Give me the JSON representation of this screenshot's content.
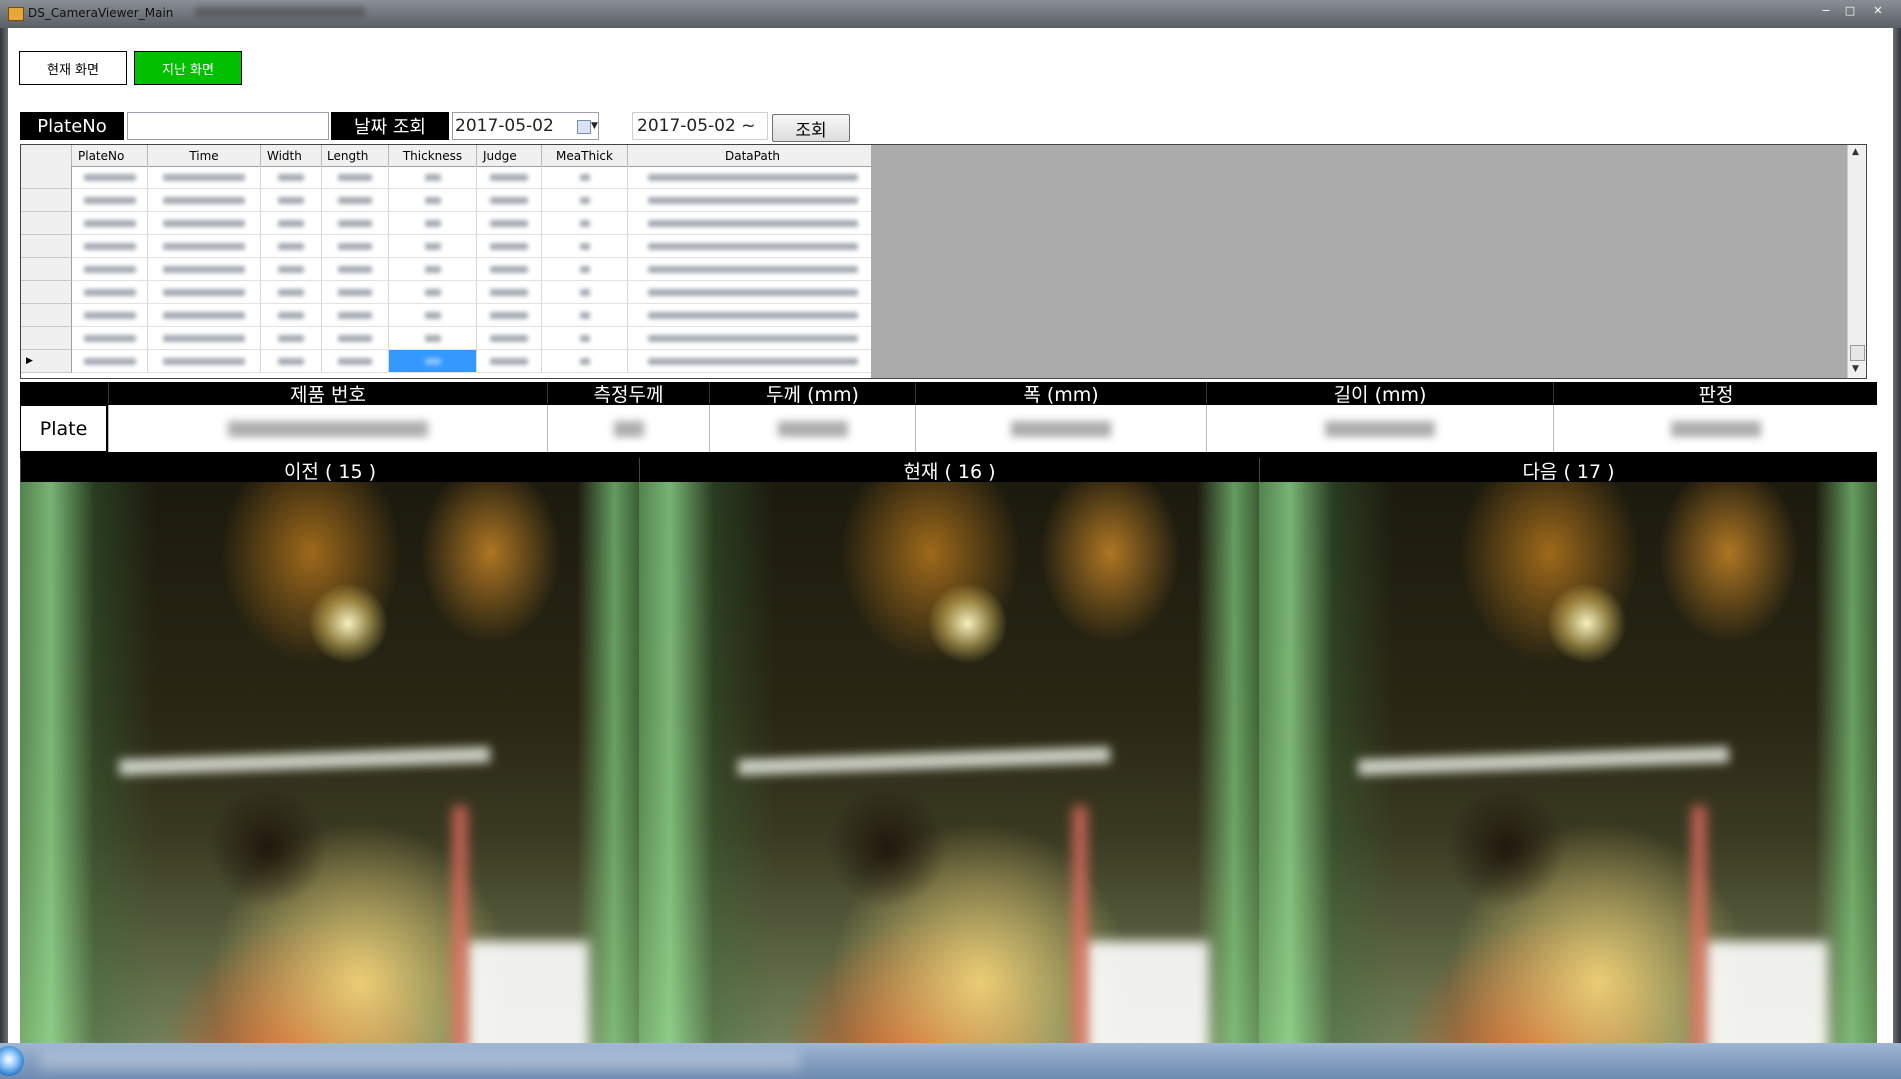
{
  "window": {
    "title": "DS_CameraViewer_Main",
    "controls": [
      "−",
      "□",
      "✕"
    ]
  },
  "mode_buttons": {
    "current": "현재 화면",
    "past": "지난 화면"
  },
  "search": {
    "plateno_label": "PlateNo",
    "plateno_value": "",
    "date_label": "날짜 조회",
    "date_from": "2017-05-02",
    "date_to": "2017-05-02 ~",
    "query_button": "조회"
  },
  "grid": {
    "columns": [
      "PlateNo",
      "Time",
      "Width",
      "Length",
      "Thickness",
      "Judge",
      "MeaThick",
      "DataPath"
    ],
    "current_row_marker": "▶",
    "row_count": 9,
    "selected_row": 8,
    "selected_column": "Thickness"
  },
  "info": {
    "headers": [
      "제품 번호",
      "측정두께",
      "두께 (mm)",
      "폭 (mm)",
      "길이 (mm)",
      "판정"
    ],
    "row_label": "Plate"
  },
  "panels": {
    "prev": "이전 ( 15 )",
    "current": "현재 ( 16 )",
    "next": "다음 ( 17 )"
  },
  "colors": {
    "accent_green": "#00c000",
    "selection_blue": "#3399ff",
    "header_black": "#000000",
    "grid_background": "#ababab"
  }
}
